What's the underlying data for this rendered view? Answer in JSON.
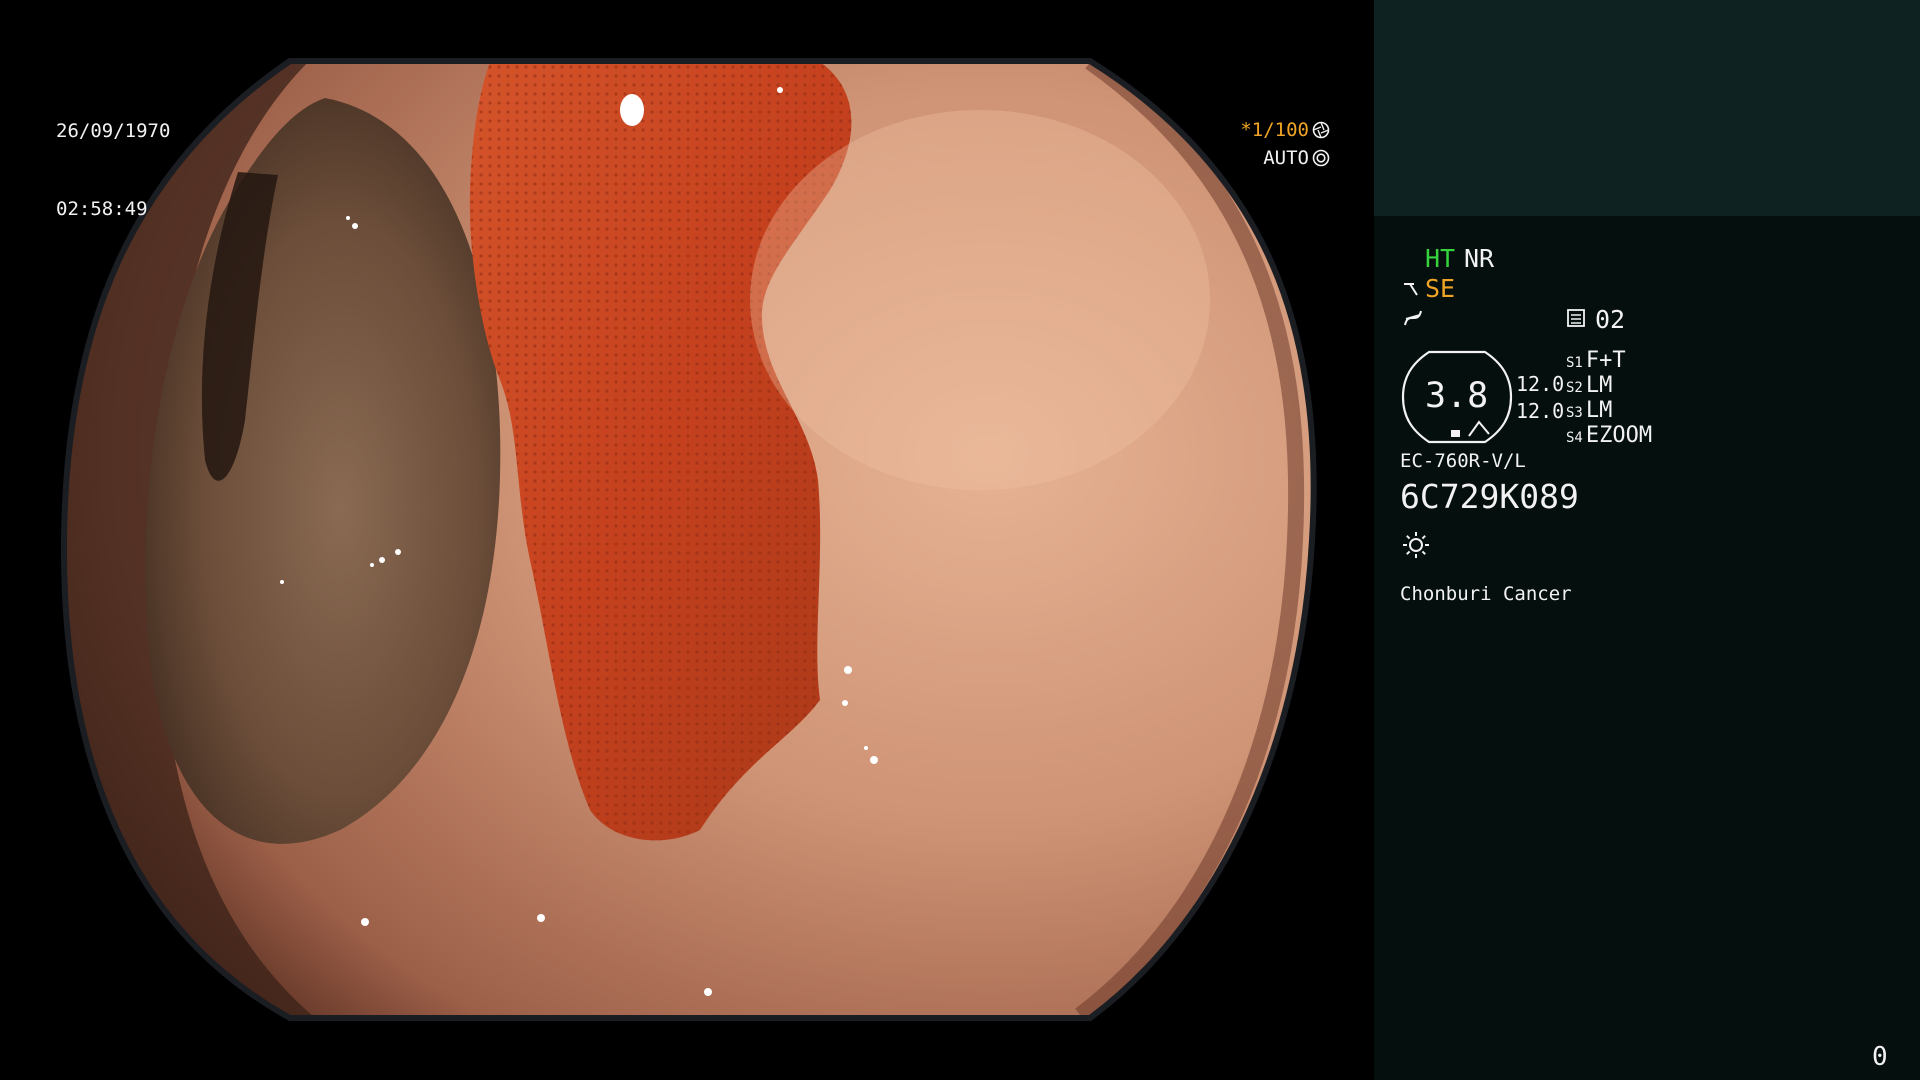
{
  "overlay": {
    "date": "26/09/1970",
    "time": "02:58:49",
    "shutter_value": "*1/100",
    "shutter_icon": "aperture-icon",
    "auto_label": "AUTO",
    "auto_icon": "iris-icon"
  },
  "panel": {
    "ht_label": "HT",
    "nr_label": "NR",
    "se_label": "SE",
    "se_icon": "scope-icon",
    "curve_icon": "curve-icon",
    "memory_icon": "list-icon",
    "memory_value": "02",
    "zoom_value": "3.8",
    "zoom_param_a": "12.0",
    "zoom_param_b": "12.0",
    "slots": [
      {
        "key": "S1",
        "value": "F+T"
      },
      {
        "key": "S2",
        "value": "LM"
      },
      {
        "key": "S3",
        "value": "LM"
      },
      {
        "key": "S4",
        "value": "EZOOM"
      }
    ],
    "scope_model": "EC-760R-V/L",
    "scope_serial": "6C729K089",
    "light_icon": "light-icon",
    "hospital": "Chonburi Cancer",
    "counter": "0"
  },
  "colors": {
    "panel_bg": "#050f0e",
    "panel_top_bg": "#0e2222",
    "ht_green": "#35d43c",
    "accent_orange": "#f0a426",
    "text_white": "#f2f2f2"
  }
}
